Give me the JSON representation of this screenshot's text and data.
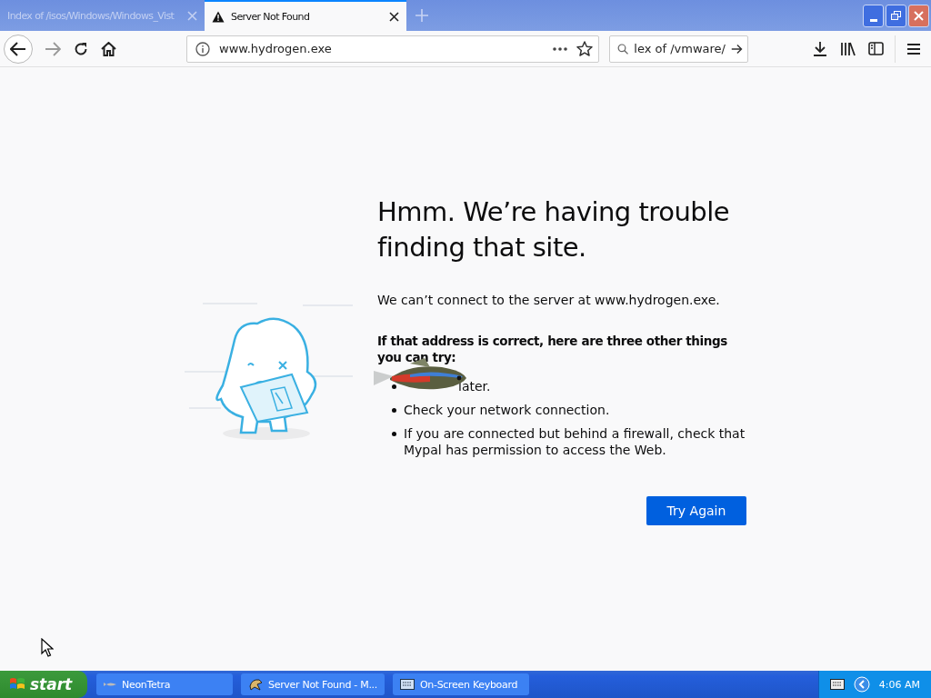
{
  "tabs": [
    {
      "title": "Index of /isos/Windows/Windows_Vist",
      "selected": false,
      "warning": false
    },
    {
      "title": "Server Not Found",
      "selected": true,
      "warning": true
    }
  ],
  "toolbar": {
    "url": "www.hydrogen.exe",
    "search_value": "lex of /vmware/"
  },
  "error": {
    "title": "Hmm. We’re having trouble finding that site.",
    "message": "We can’t connect to the server at www.hydrogen.exe.",
    "subtitle": "If that address is correct, here are three other things you can try:",
    "tips": [
      {
        "text": "later.",
        "covered": true
      },
      {
        "text": "Check your network connection.",
        "covered": false
      },
      {
        "text": "If you are connected but behind a firewall, check that Mypal has permission to access the Web.",
        "covered": false
      }
    ],
    "button": "Try Again"
  },
  "taskbar": {
    "start": "start",
    "items": [
      {
        "label": "NeonTetra",
        "selected": false,
        "kind": "fish"
      },
      {
        "label": "Server Not Found - M...",
        "selected": false,
        "kind": "browser"
      },
      {
        "label": "On-Screen Keyboard",
        "selected": false,
        "kind": "keyboard"
      }
    ],
    "clock": "4:06 AM"
  }
}
